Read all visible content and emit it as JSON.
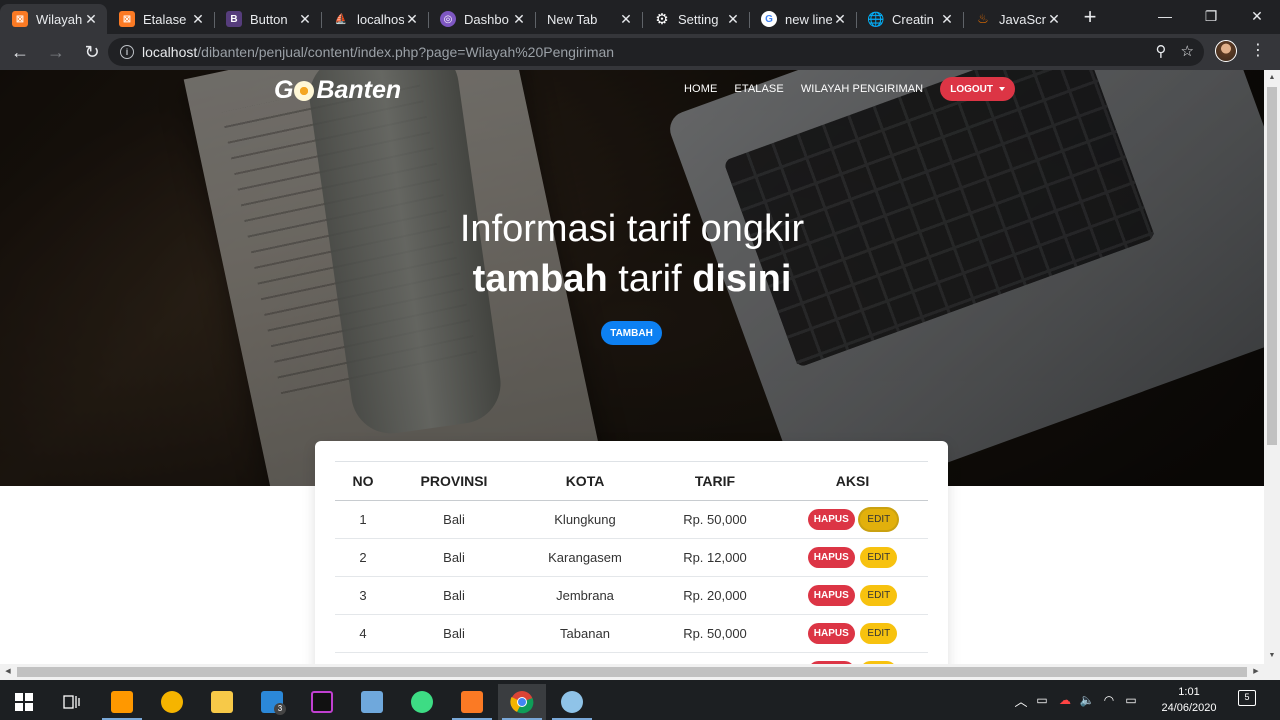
{
  "browser": {
    "tabs": [
      {
        "title": "Wilayah",
        "favicon": "xampp-icon",
        "active": true
      },
      {
        "title": "Etalase",
        "favicon": "xampp-icon",
        "active": false
      },
      {
        "title": "Button",
        "favicon": "bootstrap-icon",
        "active": false
      },
      {
        "title": "localhost",
        "favicon": "phpmyadmin-icon",
        "active": false
      },
      {
        "title": "Dashbo",
        "favicon": "dashboard-icon",
        "active": false
      },
      {
        "title": "New Tab",
        "favicon": "",
        "active": false
      },
      {
        "title": "Setting",
        "favicon": "gear-icon",
        "active": false
      },
      {
        "title": "new line",
        "favicon": "google-icon",
        "active": false
      },
      {
        "title": "Creatin",
        "favicon": "globe-icon",
        "active": false
      },
      {
        "title": "JavaScr",
        "favicon": "java-icon",
        "active": false
      }
    ],
    "url_host": "localhost",
    "url_path": "/dibanten/penjual/content/index.php?page=Wilayah%20Pengiriman"
  },
  "site": {
    "brand_pre": "G",
    "brand_post": "Banten",
    "nav": [
      "HOME",
      "ETALASE",
      "WILAYAH PENGIRIMAN"
    ],
    "logout_label": "LOGOUT",
    "hero_line1": "Informasi tarif ongkir",
    "hero_line2_a": "tambah",
    "hero_line2_b": " tarif ",
    "hero_line2_c": "disini",
    "tambah_label": "TAMBAH"
  },
  "table": {
    "headers": [
      "NO",
      "PROVINSI",
      "KOTA",
      "TARIF",
      "AKSI"
    ],
    "rows": [
      {
        "no": "1",
        "provinsi": "Bali",
        "kota": "Klungkung",
        "tarif": "Rp. 50,000"
      },
      {
        "no": "2",
        "provinsi": "Bali",
        "kota": "Karangasem",
        "tarif": "Rp. 12,000"
      },
      {
        "no": "3",
        "provinsi": "Bali",
        "kota": "Jembrana",
        "tarif": "Rp. 20,000"
      },
      {
        "no": "4",
        "provinsi": "Bali",
        "kota": "Tabanan",
        "tarif": "Rp. 50,000"
      }
    ],
    "hapus_label": "HAPUS",
    "edit_label": "EDIT"
  },
  "taskbar": {
    "clock_time": "1:01",
    "clock_date": "24/06/2020",
    "mail_badge": "3",
    "notif_count": "5"
  },
  "colors": {
    "danger": "#dc3545",
    "warning": "#f7c20f",
    "primary": "#0d80f2",
    "chrome_dark": "#202124"
  }
}
